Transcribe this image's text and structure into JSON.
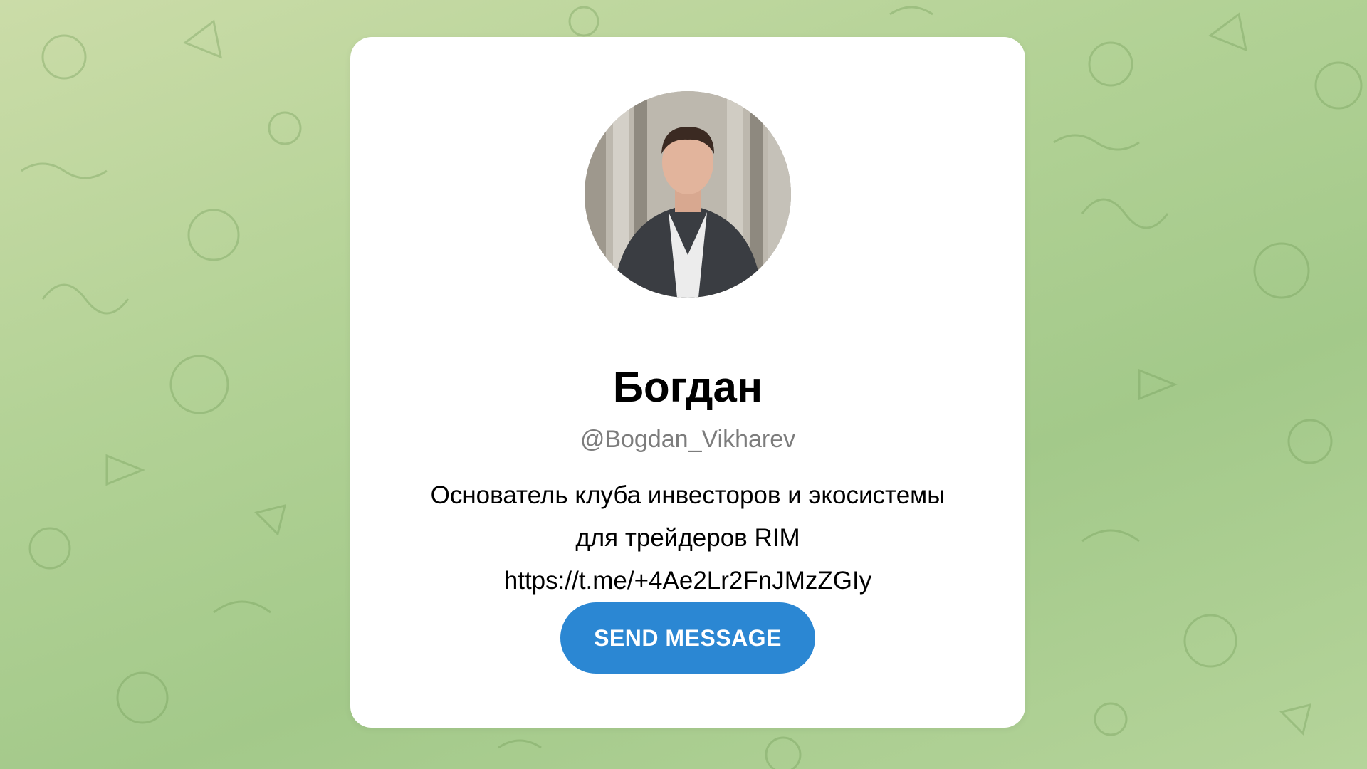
{
  "profile": {
    "name": "Богдан",
    "username": "@Bogdan_Vikharev",
    "bio_lines": [
      "Основатель клуба инвесторов и экосистемы",
      "для трейдеров RIM",
      "https://t.me/+4Ae2Lr2FnJMzZGIy"
    ]
  },
  "actions": {
    "send_message_label": "SEND MESSAGE"
  },
  "theme": {
    "accent": "#2b87d3",
    "background": "#b3d296",
    "card": "#ffffff"
  },
  "icons": {
    "background_pattern": "doodle-pattern-icons"
  }
}
